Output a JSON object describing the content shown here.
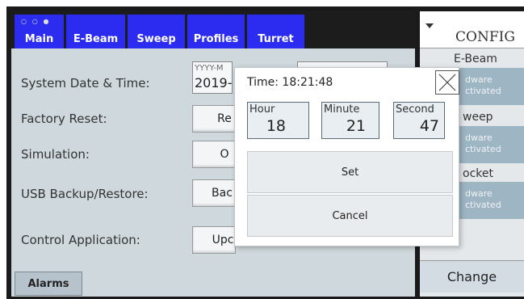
{
  "tabs": [
    {
      "label": "Main",
      "active": true
    },
    {
      "label": "E-Beam",
      "active": false
    },
    {
      "label": "Sweep",
      "active": false
    },
    {
      "label": "Profiles",
      "active": false
    },
    {
      "label": "Turret",
      "active": false
    }
  ],
  "tab_dots": "○ ○ ●",
  "settings": {
    "date_time_label": "System Date & Time:",
    "date_placeholder": "YYYY-M",
    "date_value": "2019-",
    "factory_reset_label": "Factory Reset:",
    "factory_reset_button": "Re",
    "simulation_label": "Simulation:",
    "simulation_button": "O",
    "usb_label": "USB Backup/Restore:",
    "usb_button": "Bac",
    "control_app_label": "Control Application:",
    "control_app_button": "Upc"
  },
  "alarms_label": "Alarms",
  "side": {
    "dropdown_icon": "caret-down-icon",
    "config_title": "CONFIG",
    "sections": [
      {
        "heading": "E-Beam",
        "state_line1": "dware",
        "state_line2": "ctivated"
      },
      {
        "heading": "weep",
        "state_line1": "dware",
        "state_line2": "ctivated"
      },
      {
        "heading": "ocket",
        "state_line1": "dware",
        "state_line2": "ctivated"
      }
    ],
    "change_label": "Change"
  },
  "dialog": {
    "title": "Time: 18:21:48",
    "close_icon": "close-icon",
    "fields": [
      {
        "label": "Hour",
        "value": "18"
      },
      {
        "label": "Minute",
        "value": "21"
      },
      {
        "label": "Second",
        "value": "47"
      }
    ],
    "set_label": "Set",
    "cancel_label": "Cancel"
  },
  "colors": {
    "tab_blue": "#2c2cf0",
    "panel_bg": "#cfd8dc",
    "status_tile": "#9eb5c4"
  }
}
